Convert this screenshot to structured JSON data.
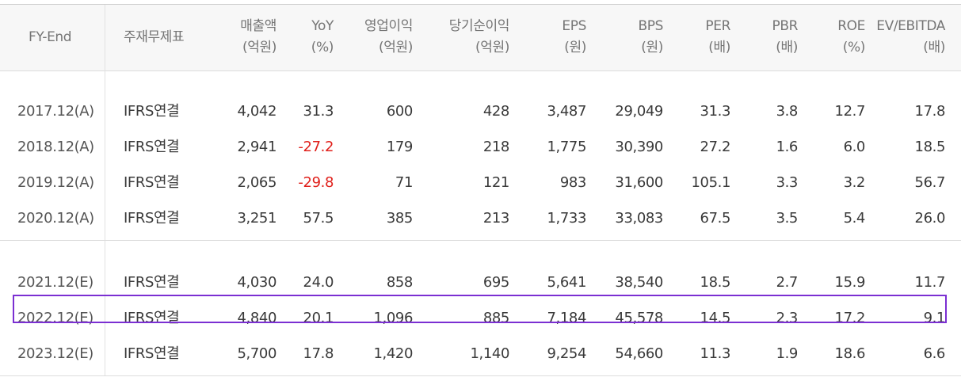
{
  "header": {
    "fy_end": "FY-End",
    "statement_type": "주재무제표",
    "columns": [
      {
        "label": "매출액",
        "unit": "(억원)"
      },
      {
        "label": "YoY",
        "unit": "(%)"
      },
      {
        "label": "영업이익",
        "unit": "(억원)"
      },
      {
        "label": "당기순이익",
        "unit": "(억원)"
      },
      {
        "label": "EPS",
        "unit": "(원)"
      },
      {
        "label": "BPS",
        "unit": "(원)"
      },
      {
        "label": "PER",
        "unit": "(배)"
      },
      {
        "label": "PBR",
        "unit": "(배)"
      },
      {
        "label": "ROE",
        "unit": "(%)"
      },
      {
        "label": "EV/EBITDA",
        "unit": "(배)"
      }
    ]
  },
  "rows": [
    {
      "fy": "2017.12(A)",
      "type": "IFRS연결",
      "values": [
        "4,042",
        "31.3",
        "600",
        "428",
        "3,487",
        "29,049",
        "31.3",
        "3.8",
        "12.7",
        "17.8"
      ]
    },
    {
      "fy": "2018.12(A)",
      "type": "IFRS연결",
      "values": [
        "2,941",
        "-27.2",
        "179",
        "218",
        "1,775",
        "30,390",
        "27.2",
        "1.6",
        "6.0",
        "18.5"
      ]
    },
    {
      "fy": "2019.12(A)",
      "type": "IFRS연결",
      "values": [
        "2,065",
        "-29.8",
        "71",
        "121",
        "983",
        "31,600",
        "105.1",
        "3.3",
        "3.2",
        "56.7"
      ]
    },
    {
      "fy": "2020.12(A)",
      "type": "IFRS연결",
      "values": [
        "3,251",
        "57.5",
        "385",
        "213",
        "1,733",
        "33,083",
        "67.5",
        "3.5",
        "5.4",
        "26.0"
      ]
    },
    {
      "fy": "2021.12(E)",
      "type": "IFRS연결",
      "values": [
        "4,030",
        "24.0",
        "858",
        "695",
        "5,641",
        "38,540",
        "18.5",
        "2.7",
        "15.9",
        "11.7"
      ]
    },
    {
      "fy": "2022.12(E)",
      "type": "IFRS연결",
      "values": [
        "4,840",
        "20.1",
        "1,096",
        "885",
        "7,184",
        "45,578",
        "14.5",
        "2.3",
        "17.2",
        "9.1"
      ]
    },
    {
      "fy": "2023.12(E)",
      "type": "IFRS연결",
      "values": [
        "5,700",
        "17.8",
        "1,420",
        "1,140",
        "9,254",
        "54,660",
        "11.3",
        "1.9",
        "18.6",
        "6.6"
      ]
    }
  ],
  "colors": {
    "negative": "#e0201b",
    "highlight_border": "#7b2fd2",
    "header_bg": "#f7f7f7"
  },
  "highlighted_row": "2022.12(E)"
}
